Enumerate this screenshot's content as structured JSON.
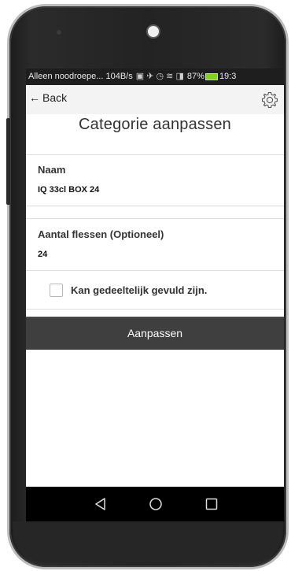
{
  "status_bar": {
    "carrier": "Alleen noodroepe...",
    "speed": "104B/s",
    "battery_pct": "87%",
    "time": "19:3"
  },
  "action_bar": {
    "back_label": "Back",
    "settings_icon": "gear-icon"
  },
  "page": {
    "title": "Categorie aanpassen"
  },
  "form": {
    "name_label": "Naam",
    "name_value": "IQ 33cl BOX 24",
    "bottles_label": "Aantal flessen (Optioneel)",
    "bottles_value": "24",
    "partial_checkbox_label": "Kan gedeeltelijk gevuld zijn.",
    "partial_checked": false,
    "submit_label": "Aanpassen"
  },
  "nav_bar": {
    "back_icon": "nav-back-icon",
    "home_icon": "nav-home-icon",
    "recents_icon": "nav-recents-icon"
  },
  "colors": {
    "submit_bg": "#3f3f3f",
    "status_bg": "#1e1e1e",
    "battery": "#7ed321"
  }
}
